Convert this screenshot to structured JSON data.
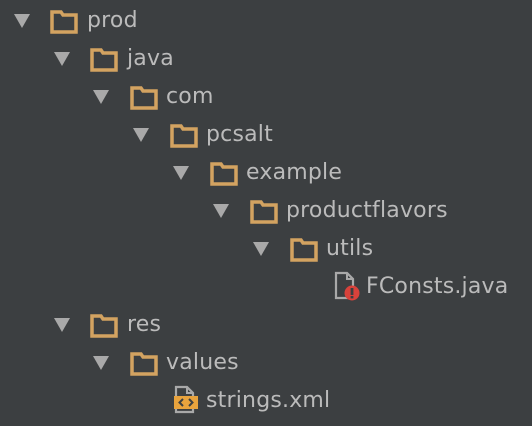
{
  "colors": {
    "background": "#3c3f41",
    "text": "#bbbbbb",
    "arrow": "#a9a9a9",
    "folder": "#d3a361",
    "java_badge": "#d9423b",
    "xml_icon": "#e8a33d"
  },
  "tree": {
    "nodes": [
      {
        "label": "prod",
        "icon": "folder-icon",
        "expanded": true
      },
      {
        "label": "java",
        "icon": "folder-icon",
        "expanded": true
      },
      {
        "label": "com",
        "icon": "folder-icon",
        "expanded": true
      },
      {
        "label": "pcsalt",
        "icon": "folder-icon",
        "expanded": true
      },
      {
        "label": "example",
        "icon": "folder-icon",
        "expanded": true
      },
      {
        "label": "productflavors",
        "icon": "folder-icon",
        "expanded": true
      },
      {
        "label": "utils",
        "icon": "folder-icon",
        "expanded": true
      },
      {
        "label": "FConsts.java",
        "icon": "java-file-icon"
      },
      {
        "label": "res",
        "icon": "folder-icon",
        "expanded": true
      },
      {
        "label": "values",
        "icon": "folder-icon",
        "expanded": true
      },
      {
        "label": "strings.xml",
        "icon": "xml-file-icon"
      }
    ]
  }
}
